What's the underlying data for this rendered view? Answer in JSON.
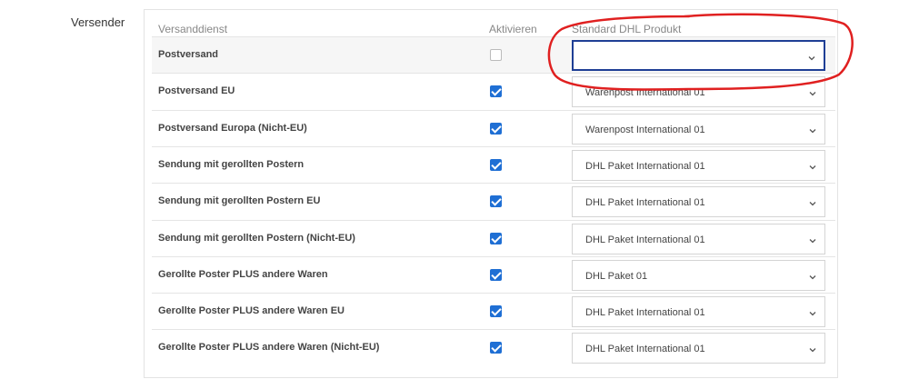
{
  "section": {
    "label": "Versender"
  },
  "table": {
    "headers": [
      "Versanddienst",
      "Aktivieren",
      "Standard DHL Produkt"
    ],
    "rows": [
      {
        "name": "Postversand",
        "enabled": false,
        "product": ""
      },
      {
        "name": "Postversand EU",
        "enabled": true,
        "product": "Warenpost International 01"
      },
      {
        "name": "Postversand Europa (Nicht-EU)",
        "enabled": true,
        "product": "Warenpost International 01"
      },
      {
        "name": "Sendung mit gerollten Postern",
        "enabled": true,
        "product": "DHL Paket International 01"
      },
      {
        "name": "Sendung mit gerollten Postern EU",
        "enabled": true,
        "product": "DHL Paket International 01"
      },
      {
        "name": "Sendung mit gerollten Postern (Nicht-EU)",
        "enabled": true,
        "product": "DHL Paket International 01"
      },
      {
        "name": "Gerollte Poster PLUS andere Waren",
        "enabled": true,
        "product": "DHL Paket 01"
      },
      {
        "name": "Gerollte Poster PLUS andere Waren EU",
        "enabled": true,
        "product": "DHL Paket International 01"
      },
      {
        "name": "Gerollte Poster PLUS andere Waren (Nicht-EU)",
        "enabled": true,
        "product": "DHL Paket International 01"
      }
    ]
  },
  "colors": {
    "accent": "#1f6fd4",
    "focus_border": "#1f3f95",
    "annotation": "#e02020"
  },
  "icons": {
    "select": "chevron-down-icon"
  }
}
